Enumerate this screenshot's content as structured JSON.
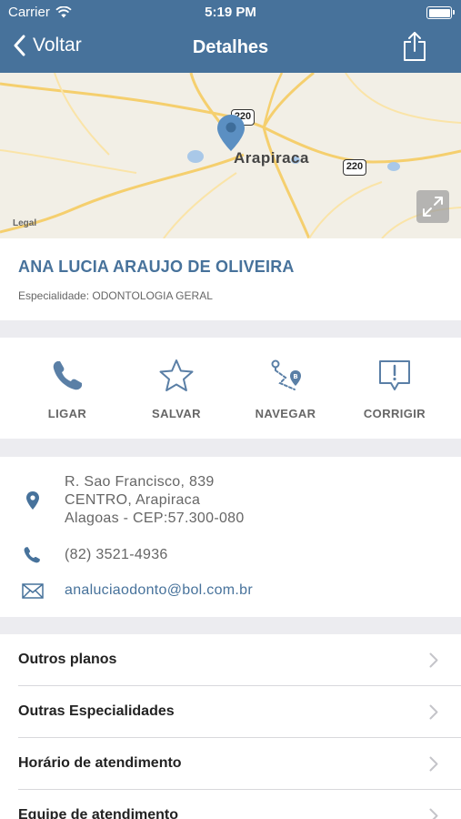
{
  "status_bar": {
    "carrier": "Carrier",
    "time": "5:19 PM"
  },
  "nav": {
    "back_label": "Voltar",
    "title": "Detalhes"
  },
  "map": {
    "city_label": "Arapiraca",
    "legal_label": "Legal",
    "road_shield_1": "220",
    "road_shield_2": "220"
  },
  "provider": {
    "name": "ANA LUCIA ARAUJO DE OLIVEIRA",
    "specialty": "Especialidade: ODONTOLOGIA GERAL"
  },
  "actions": [
    {
      "label": "LIGAR",
      "icon": "phone-icon"
    },
    {
      "label": "SALVAR",
      "icon": "star-icon"
    },
    {
      "label": "NAVEGAR",
      "icon": "route-icon"
    },
    {
      "label": "CORRIGIR",
      "icon": "alert-message-icon"
    }
  ],
  "contact": {
    "address_lines": [
      "R. Sao Francisco, 839",
      "CENTRO, Arapiraca",
      "Alagoas - CEP:57.300-080"
    ],
    "phone": "(82) 3521-4936",
    "email": "analuciaodonto@bol.com.br"
  },
  "menu": [
    {
      "label": "Outros planos"
    },
    {
      "label": "Outras Especialidades"
    },
    {
      "label": "Horário de atendimento"
    },
    {
      "label": "Equipe de atendimento"
    }
  ],
  "colors": {
    "brand": "#47729b",
    "background": "#ececf0",
    "label_gray": "#666666"
  }
}
